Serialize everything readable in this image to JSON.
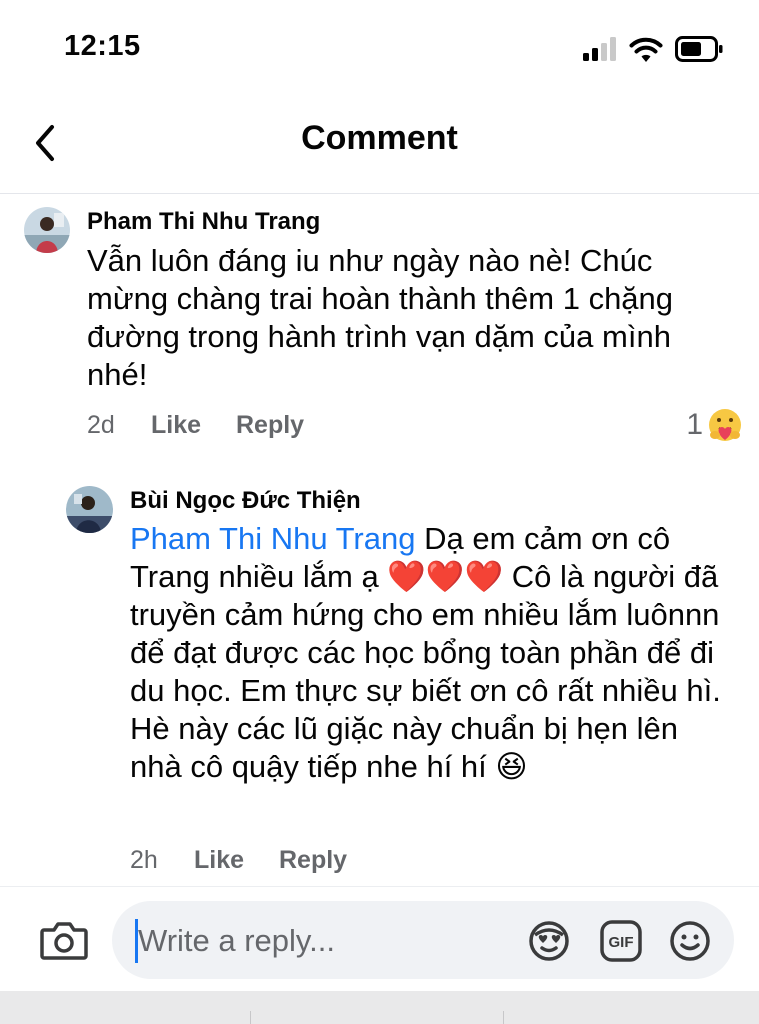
{
  "status_bar": {
    "time": "12:15"
  },
  "nav": {
    "title": "Comment"
  },
  "comments": [
    {
      "author": "Pham Thi Nhu Trang",
      "text": "Vẫn luôn đáng iu như ngày nào nè! Chúc mừng chàng trai hoàn thành thêm 1 chặng đường trong hành trình vạn dặm của mình nhé!",
      "time": "2d",
      "like_label": "Like",
      "reply_label": "Reply",
      "reaction_count": "1",
      "reaction_icon": "care-reaction-icon"
    },
    {
      "author": "Bùi Ngọc Đức Thiện",
      "mention": "Pham Thi Nhu Trang",
      "text_a": " Dạ em cảm ơn cô Trang nhiều lắm ạ ",
      "hearts": "❤️❤️❤️",
      "text_b": " Cô là người đã truyền cảm hứng cho em nhiều lắm luônnn để đạt được các học bổng toàn phần để đi du học. Em thực sự biết ơn cô rất nhiều hì. Hè này các lũ giặc này chuẩn bị hẹn lên nhà cô quậy tiếp nhe hí hí ",
      "emoji": "😆",
      "time": "2h",
      "like_label": "Like",
      "reply_label": "Reply"
    }
  ],
  "composer": {
    "placeholder": "Write a reply...",
    "icons": [
      "camera-icon",
      "avatar-sticker-icon",
      "gif-icon",
      "emoji-icon"
    ]
  },
  "colors": {
    "accent": "#1877f2",
    "secondary_text": "#65676b",
    "input_bg": "#f0f2f5"
  }
}
